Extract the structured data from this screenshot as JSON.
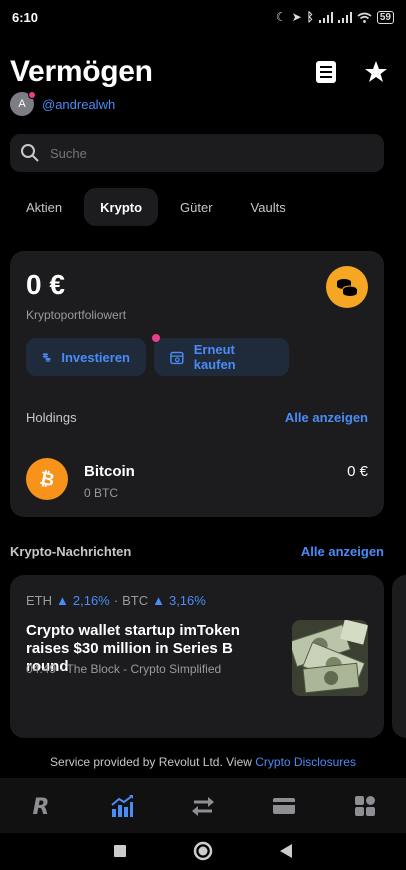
{
  "status_bar": {
    "time": "6:10",
    "battery": "59"
  },
  "header": {
    "title": "Vermögen",
    "username": "@andrealwh",
    "avatar_initial": "A"
  },
  "search": {
    "placeholder": "Suche"
  },
  "tabs": [
    {
      "label": "Aktien",
      "active": false
    },
    {
      "label": "Krypto",
      "active": true
    },
    {
      "label": "Güter",
      "active": false
    },
    {
      "label": "Vaults",
      "active": false
    }
  ],
  "portfolio": {
    "balance": "0 €",
    "balance_label": "Kryptoportfoliowert",
    "invest_label": "Investieren",
    "rebuy_label": "Erneut kaufen",
    "holdings_label": "Holdings",
    "see_all": "Alle anzeigen",
    "holding": {
      "name": "Bitcoin",
      "amount": "0 BTC",
      "value": "0 €"
    }
  },
  "news": {
    "section_title": "Krypto-Nachrichten",
    "see_all": "Alle anzeigen",
    "ticker1": "ETH",
    "ticker1_change": "2,16%",
    "ticker_sep": "·",
    "ticker2": "BTC",
    "ticker2_change": "3,16%",
    "headline": "Crypto wallet startup imToken raises $30 million in Series B round",
    "meta": "04:49 · The Block - Crypto Simplified"
  },
  "disclaimer": {
    "text": "Service provided by Revolut Ltd. View ",
    "link": "Crypto Disclosures"
  },
  "colors": {
    "accent": "#4a8cf7",
    "bitcoin": "#f7931a",
    "coins": "#f5a623",
    "notification": "#e83e8c"
  },
  "icons": {
    "header": [
      "document-icon",
      "star-icon"
    ],
    "bottom_nav": [
      "revolut-logo-icon",
      "wealth-chart-icon",
      "transfer-arrows-icon",
      "card-icon",
      "hub-grid-icon"
    ],
    "system_nav": [
      "recents-square-icon",
      "home-circle-icon",
      "back-triangle-icon"
    ]
  }
}
